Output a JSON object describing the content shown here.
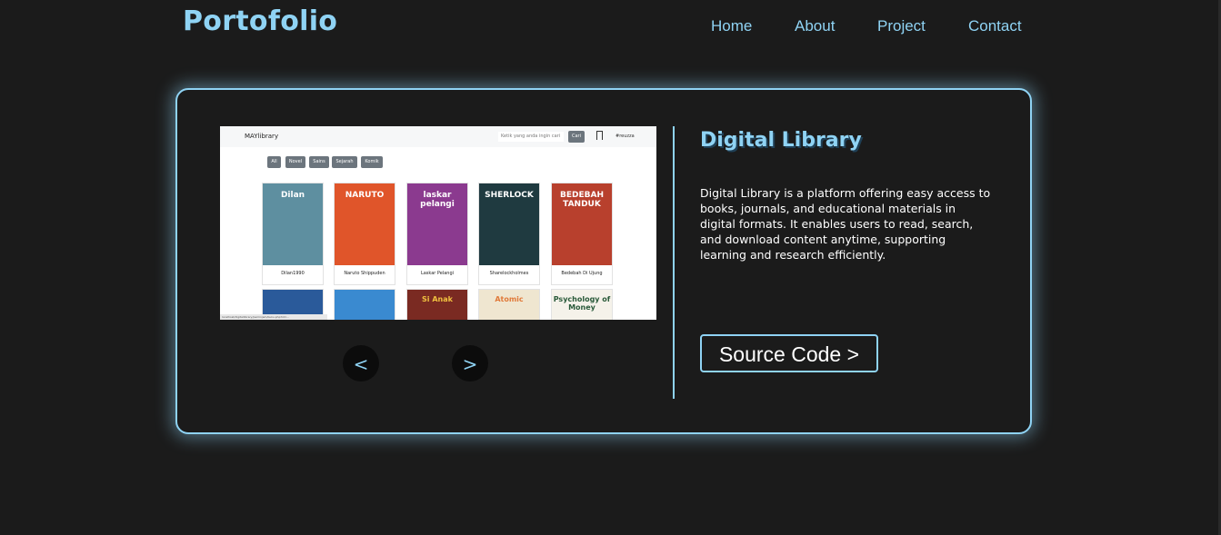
{
  "header": {
    "logo": "Portofolio",
    "nav": [
      {
        "label": "Home"
      },
      {
        "label": "About"
      },
      {
        "label": "Project"
      },
      {
        "label": "Contact"
      }
    ]
  },
  "project": {
    "title": "Digital Library",
    "description": "Digital Library is a platform offering easy access to books, journals, and educational materials in digital formats. It enables users to read, search, and download content anytime, supporting learning and research efficiently.",
    "source_button": "Source Code >",
    "prev_button": "<",
    "next_button": ">"
  },
  "screenshot": {
    "brand": "MAYlibrary",
    "search_placeholder": "Ketik yang anda ingin cari",
    "search_button": "Cari",
    "user": "#reuzza",
    "filters": [
      "All",
      "Novel",
      "Sains",
      "Sejarah",
      "Komik"
    ],
    "books": [
      {
        "title": "Dilan1990",
        "cover_text": "Dilan",
        "color": "#5e8fa0"
      },
      {
        "title": "Naruto Shippuden",
        "cover_text": "NARUTO",
        "color": "#e0552a"
      },
      {
        "title": "Laskar Pelangi",
        "cover_text": "laskar pelangi",
        "color": "#8b3a8f"
      },
      {
        "title": "Sharelockholmes",
        "cover_text": "SHERLOCK",
        "color": "#1f3a40"
      },
      {
        "title": "Bedebah Di Ujung",
        "cover_text": "BEDEBAH TANDUK",
        "color": "#b8402d"
      }
    ],
    "books_row2": [
      {
        "cover_text": "",
        "color": "#2a5a9a"
      },
      {
        "cover_text": "",
        "color": "#3a8ad0"
      },
      {
        "cover_text": "Si Anak",
        "color": "#7a2a22"
      },
      {
        "cover_text": "Atomic",
        "color": "#efe6d0"
      },
      {
        "cover_text": "Psychology of Money",
        "color": "#f5f2ea"
      }
    ],
    "status_url": "localhost/digitallibrary/peminjam/buku.php?id=..."
  }
}
